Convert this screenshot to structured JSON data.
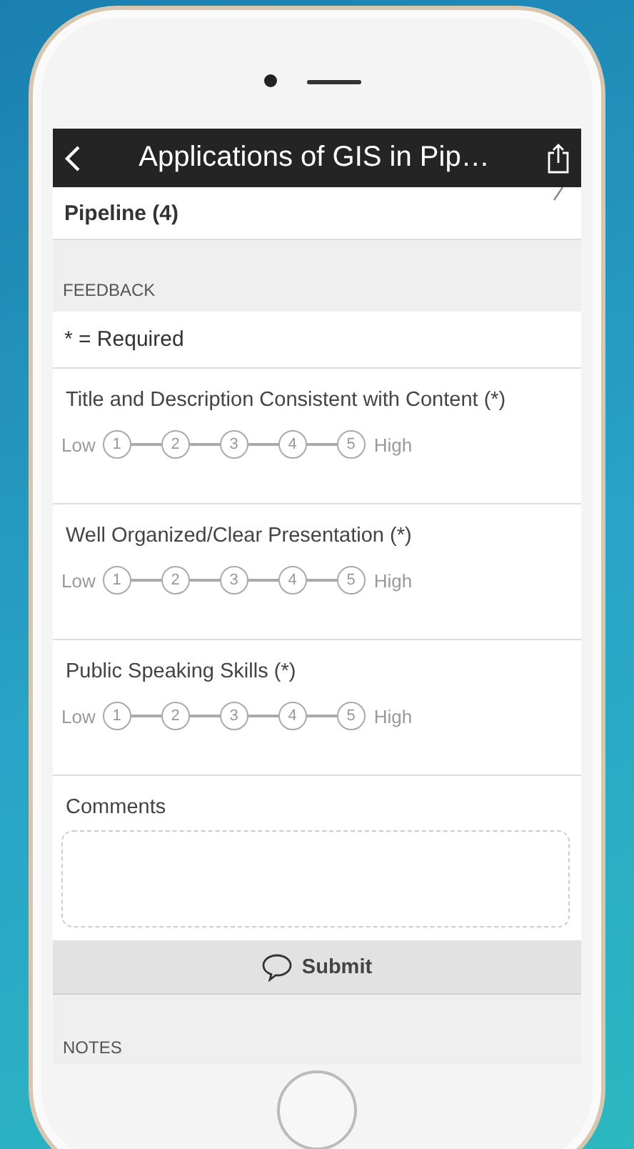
{
  "nav_bar": {
    "title": "Applications of GIS in Pip…"
  },
  "header_row": {
    "title": "Pipeline (4)"
  },
  "section_header": "FEEDBACK",
  "required_note": "* = Required",
  "questions": [
    {
      "label": "Title and Description Consistent with Content (*)",
      "low_label": "Low",
      "high_label": "High",
      "options": [
        {
          "label": "1",
          "selected": false
        },
        {
          "label": "2",
          "selected": false
        },
        {
          "label": "3",
          "selected": false
        },
        {
          "label": "4",
          "selected": false
        },
        {
          "label": "5",
          "selected": false
        }
      ]
    },
    {
      "label": "Well Organized/Clear Presentation (*)",
      "low_label": "Low",
      "high_label": "High",
      "options": [
        {
          "label": "1",
          "selected": false
        },
        {
          "label": "2",
          "selected": false
        },
        {
          "label": "3",
          "selected": false
        },
        {
          "label": "4",
          "selected": false
        },
        {
          "label": "5",
          "selected": false
        }
      ]
    },
    {
      "label": "Public Speaking Skills (*)",
      "low_label": "Low",
      "high_label": "High",
      "options": [
        {
          "label": "1",
          "selected": false
        },
        {
          "label": "2",
          "selected": false
        },
        {
          "label": "3",
          "selected": false
        },
        {
          "label": "4",
          "selected": false
        },
        {
          "label": "5",
          "selected": false
        }
      ]
    }
  ],
  "comments": {
    "label": "Comments"
  },
  "submit_button": "Submit",
  "notes_header": "NOTES"
}
